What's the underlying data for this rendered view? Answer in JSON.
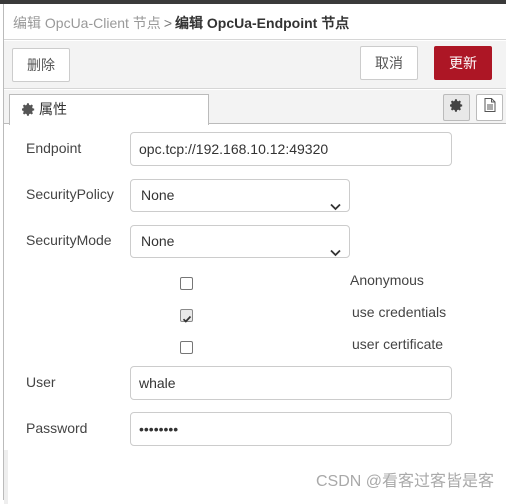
{
  "breadcrumb": {
    "previous": "编辑 OpcUa-Client 节点",
    "separator": ">",
    "current": "编辑 OpcUa-Endpoint 节点"
  },
  "toolbar": {
    "delete_label": "删除",
    "cancel_label": "取消",
    "update_label": "更新",
    "update_color": "#ad1625"
  },
  "tabs": [
    {
      "label": "属性",
      "icon": "gear-icon",
      "active": true
    }
  ],
  "tab_icons": [
    "settings-icon",
    "document-icon"
  ],
  "form": {
    "endpoint": {
      "label": "Endpoint",
      "value": "opc.tcp://192.168.10.12:49320"
    },
    "security_policy": {
      "label": "SecurityPolicy",
      "value": "None"
    },
    "security_mode": {
      "label": "SecurityMode",
      "value": "None"
    },
    "options": [
      {
        "label": "Anonymous",
        "checked": false
      },
      {
        "label": "use credentials",
        "checked": true
      },
      {
        "label": "user certificate",
        "checked": false
      }
    ],
    "user": {
      "label": "User",
      "value": "whale"
    },
    "password": {
      "label": "Password",
      "value": "••••••••"
    }
  },
  "watermark": "CSDN @看客过客皆是客"
}
